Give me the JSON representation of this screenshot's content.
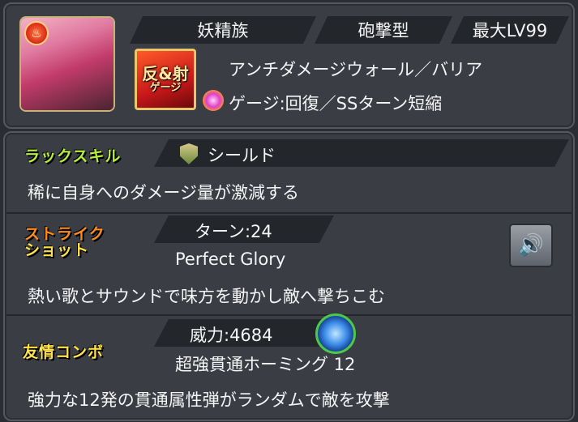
{
  "header": {
    "element_icon": "fire-element-icon",
    "race": "妖精族",
    "type": "砲撃型",
    "max_level": "最大LV99",
    "gimmick_badge": {
      "line1": "反&射",
      "line2": "ゲージ"
    },
    "ability": "アンチダメージウォール／バリア",
    "gauge": "ゲージ:回復／SSターン短縮"
  },
  "luck_skill": {
    "label": "ラックスキル",
    "name": "シールド",
    "description": "稀に自身へのダメージ量が激減する"
  },
  "strike_shot": {
    "label_line1": "ストライク",
    "label_line2": "ショット",
    "turns": "ターン:24",
    "name": "Perfect Glory",
    "description": "熱い歌とサウンドで味方を動かし敵へ撃ちこむ"
  },
  "friendship_combo": {
    "label": "友情コンボ",
    "power": "威力:4684",
    "name": "超強貫通ホーミング 12",
    "description": "強力な12発の貫通属性弾がランダムで敵を攻撃"
  }
}
